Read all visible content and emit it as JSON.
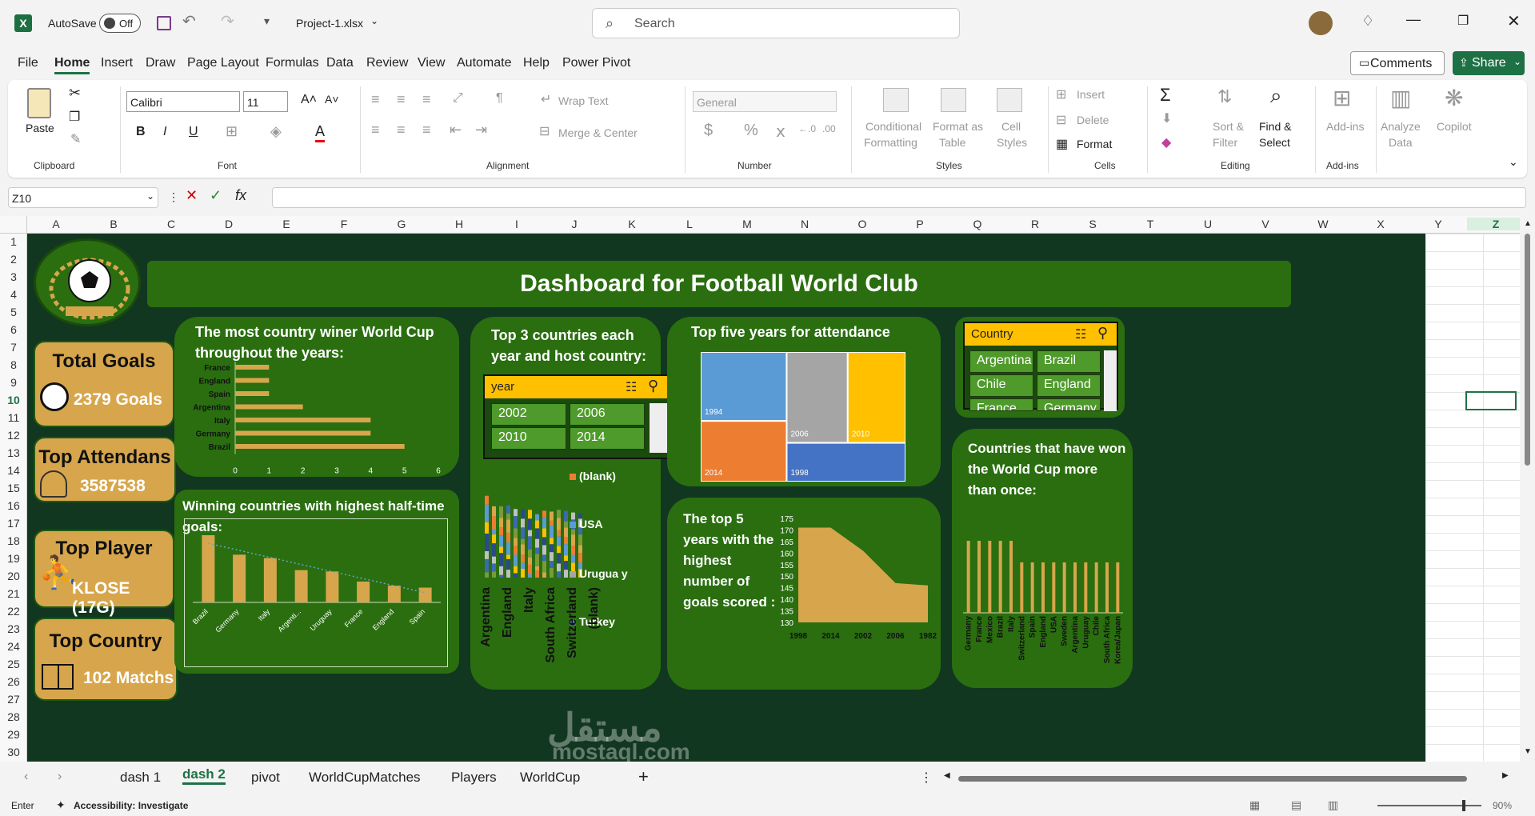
{
  "app": {
    "autosave_label": "AutoSave",
    "autosave_state": "Off",
    "file_name": "Project-1.xlsx",
    "search_placeholder": "Search",
    "comments_label": "Comments",
    "share_label": "Share"
  },
  "menu": [
    "File",
    "Home",
    "Insert",
    "Draw",
    "Page Layout",
    "Formulas",
    "Data",
    "Review",
    "View",
    "Automate",
    "Help",
    "Power Pivot"
  ],
  "ribbon": {
    "paste": "Paste",
    "clipboard": "Clipboard",
    "font_name": "Calibri",
    "font_size": "11",
    "font": "Font",
    "wrap_text": "Wrap Text",
    "merge_center": "Merge & Center",
    "alignment": "Alignment",
    "number_format": "General",
    "number": "Number",
    "cond_format_1": "Conditional",
    "cond_format_2": "Formatting",
    "format_table_1": "Format as",
    "format_table_2": "Table",
    "cell_styles_1": "Cell",
    "cell_styles_2": "Styles",
    "styles": "Styles",
    "insert": "Insert",
    "delete": "Delete",
    "format": "Format",
    "cells": "Cells",
    "sort_1": "Sort &",
    "sort_2": "Filter",
    "find_1": "Find &",
    "find_2": "Select",
    "editing": "Editing",
    "addins": "Add-ins",
    "addins_grp": "Add-ins",
    "analyze_1": "Analyze",
    "analyze_2": "Data",
    "copilot": "Copilot"
  },
  "formula_bar": {
    "name_box": "Z10",
    "fx": "fx",
    "content": ""
  },
  "columns": [
    "A",
    "B",
    "C",
    "D",
    "E",
    "F",
    "G",
    "H",
    "I",
    "J",
    "K",
    "L",
    "M",
    "N",
    "O",
    "P",
    "Q",
    "R",
    "S",
    "T",
    "U",
    "V",
    "W",
    "X",
    "Y",
    "Z"
  ],
  "rows": [
    "1",
    "2",
    "3",
    "4",
    "5",
    "6",
    "7",
    "8",
    "9",
    "10",
    "11",
    "12",
    "13",
    "14",
    "15",
    "16",
    "17",
    "18",
    "19",
    "20",
    "21",
    "22",
    "23",
    "24",
    "25",
    "26",
    "27",
    "28",
    "29",
    "30"
  ],
  "dashboard": {
    "title": "Dashboard for Football World Club",
    "kpis": [
      {
        "title": "Total Goals",
        "value": "2379 Goals"
      },
      {
        "title": "Top Attendans",
        "value": "3587538"
      },
      {
        "title": "Top Player",
        "value": "KLOSE (17G)"
      },
      {
        "title": "Top Country",
        "value": "102 Matchs"
      }
    ],
    "panel_titles": {
      "winner": "The most country winer World Cup throughout the years:",
      "halftime": "Winning countries with highest half-time goals:",
      "top3": "Top 3 countries each year and host country:",
      "attendance": "Top five years for attendance",
      "goals": "The top 5 years with the highest number of goals scored :",
      "more_than_once": "Countries that have won the World Cup more than once:"
    },
    "year_slicer": {
      "header": "year",
      "items": [
        "2002",
        "2006",
        "2010",
        "2014"
      ]
    },
    "country_slicer": {
      "header": "Country",
      "items": [
        "Argentina",
        "Brazil",
        "Chile",
        "England",
        "France",
        "Germany"
      ]
    },
    "top3_legend": [
      "(blank)",
      "USA",
      "Urugua y",
      "Turkey"
    ],
    "top3_axis": [
      "Argentina",
      "England",
      "Italy",
      "South Africa",
      "Switzerland",
      "(blank)"
    ],
    "watermark_1": "مستقل",
    "watermark_2": "mostaql.com"
  },
  "chart_data": [
    {
      "type": "bar",
      "orientation": "horizontal",
      "categories": [
        "France",
        "England",
        "Spain",
        "Argentina",
        "Italy",
        "Germany",
        "Brazil"
      ],
      "values": [
        1,
        1,
        1,
        2,
        4,
        4,
        5
      ],
      "xlim": [
        0,
        6
      ],
      "xticks": [
        0,
        1,
        2,
        3,
        4,
        5,
        6
      ],
      "color": "#d7a64c"
    },
    {
      "type": "bar",
      "categories": [
        "Brazil",
        "Germany",
        "Italy",
        "Argenti...",
        "Uruguay",
        "France",
        "England",
        "Spain"
      ],
      "values": [
        10,
        7.1,
        6.6,
        4.8,
        4.6,
        3.1,
        2.5,
        2.2
      ],
      "trendline": true,
      "color": "#d7a64c"
    },
    {
      "type": "treemap",
      "items": [
        {
          "label": "1994",
          "value": 3587538,
          "color": "#5b9bd5"
        },
        {
          "label": "2006",
          "value": 3359439,
          "color": "#a5a5a5"
        },
        {
          "label": "2010",
          "value": 3178856,
          "color": "#ffc000"
        },
        {
          "label": "2014",
          "value": 3157000,
          "color": "#ed7d31"
        },
        {
          "label": "1998",
          "value": 2785100,
          "color": "#4472c4"
        }
      ]
    },
    {
      "type": "area",
      "categories": [
        "1998",
        "2014",
        "2002",
        "2006",
        "1982"
      ],
      "values": [
        171,
        171,
        161,
        147,
        146
      ],
      "ylim": [
        130,
        175
      ],
      "yticks": [
        130,
        135,
        140,
        145,
        150,
        155,
        160,
        165,
        170,
        175
      ],
      "color": "#d7a64c"
    },
    {
      "type": "bar",
      "categories": [
        "Germany",
        "France",
        "Mexico",
        "Brazil",
        "Italy",
        "Switzerland",
        "Spain",
        "England",
        "USA",
        "Sweden",
        "Argentina",
        "Uruguay",
        "Chile",
        "South Africa",
        "Korea/Japan"
      ],
      "values": [
        5,
        5,
        5,
        5,
        5,
        3.5,
        3.5,
        3.5,
        3.5,
        3.5,
        3.5,
        3.5,
        3.5,
        3.5,
        3.5
      ],
      "color": "#d7a64c"
    }
  ],
  "sheet_tabs": [
    "dash 1",
    "dash 2",
    "pivot",
    "WorldCupMatches",
    "Players",
    "WorldCup"
  ],
  "status": {
    "mode": "Enter",
    "accessibility": "Accessibility: Investigate",
    "zoom": "90%"
  }
}
